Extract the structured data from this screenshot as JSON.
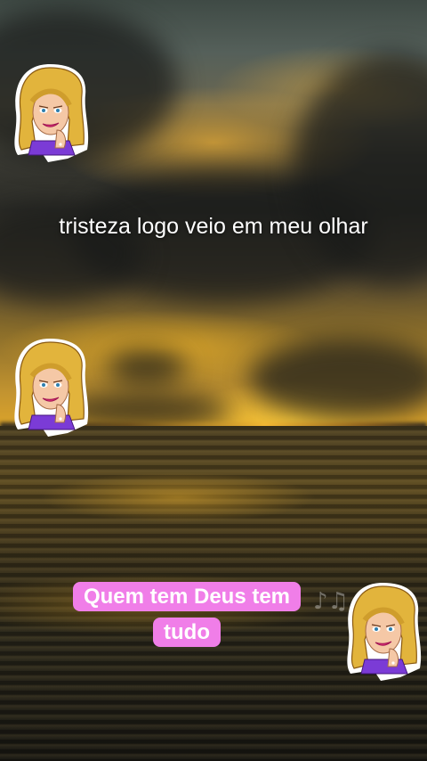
{
  "caption": {
    "text": "tristeza logo veio em meu olhar"
  },
  "highlight": {
    "text": "Quem tem Deus tem tudo",
    "background_color": "#f07ee8"
  },
  "stickers": [
    {
      "icon": "woman-cartoon-sticker"
    },
    {
      "icon": "woman-cartoon-sticker"
    },
    {
      "icon": "woman-cartoon-sticker"
    }
  ],
  "decorations": {
    "music_notes": "♪♫"
  }
}
